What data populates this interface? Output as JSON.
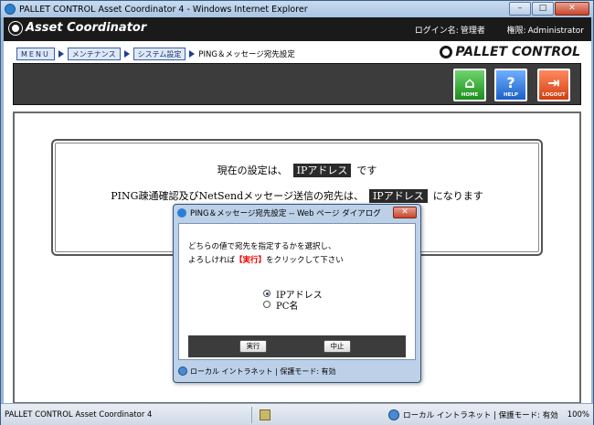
{
  "window": {
    "title": "PALLET CONTROL Asset Coordinator 4 - Windows Internet Explorer",
    "min": "–",
    "max": "□",
    "close": "✕"
  },
  "header": {
    "logo_text": "Asset Coordinator",
    "login_label": "ログイン名:",
    "login_value": "管理者",
    "authority_label": "権限:",
    "authority_value": "Administrator"
  },
  "breadcrumb": {
    "items": [
      "MENU",
      "メンテナンス",
      "システム設定"
    ],
    "current": "PING＆メッセージ宛先設定"
  },
  "brand": "PALLET CONTROL",
  "toolbar": {
    "home": "HOME",
    "help": "HELP",
    "logout": "LOGOUT"
  },
  "main": {
    "line1_pre": "現在の設定は、",
    "line1_value": "IPアドレス",
    "line1_post": "です",
    "line2_pre": "PING疎通確認及びNetSendメッセージ送信の宛先は、",
    "line2_value": "IPアドレス",
    "line2_post": "になります"
  },
  "dialog": {
    "title": "PING＆メッセージ宛先設定 -- Web ページ ダイアログ",
    "close": "✕",
    "text_line1": "どちらの値で宛先を指定するかを選択し、",
    "text_line2_pre": "よろしければ",
    "text_line2_red": "【実行】",
    "text_line2_post": "をクリックして下さい",
    "options": [
      {
        "label": "IPアドレス",
        "selected": true
      },
      {
        "label": "PC名",
        "selected": false
      }
    ],
    "exec_button": "実行",
    "cancel_button": "中止",
    "status": "ローカル イントラネット | 保護モード: 有効"
  },
  "statusbar": {
    "left": "PALLET CONTROL Asset Coordinator 4",
    "zone": "ローカル イントラネット | 保護モード: 有効",
    "zoom": "100%"
  }
}
